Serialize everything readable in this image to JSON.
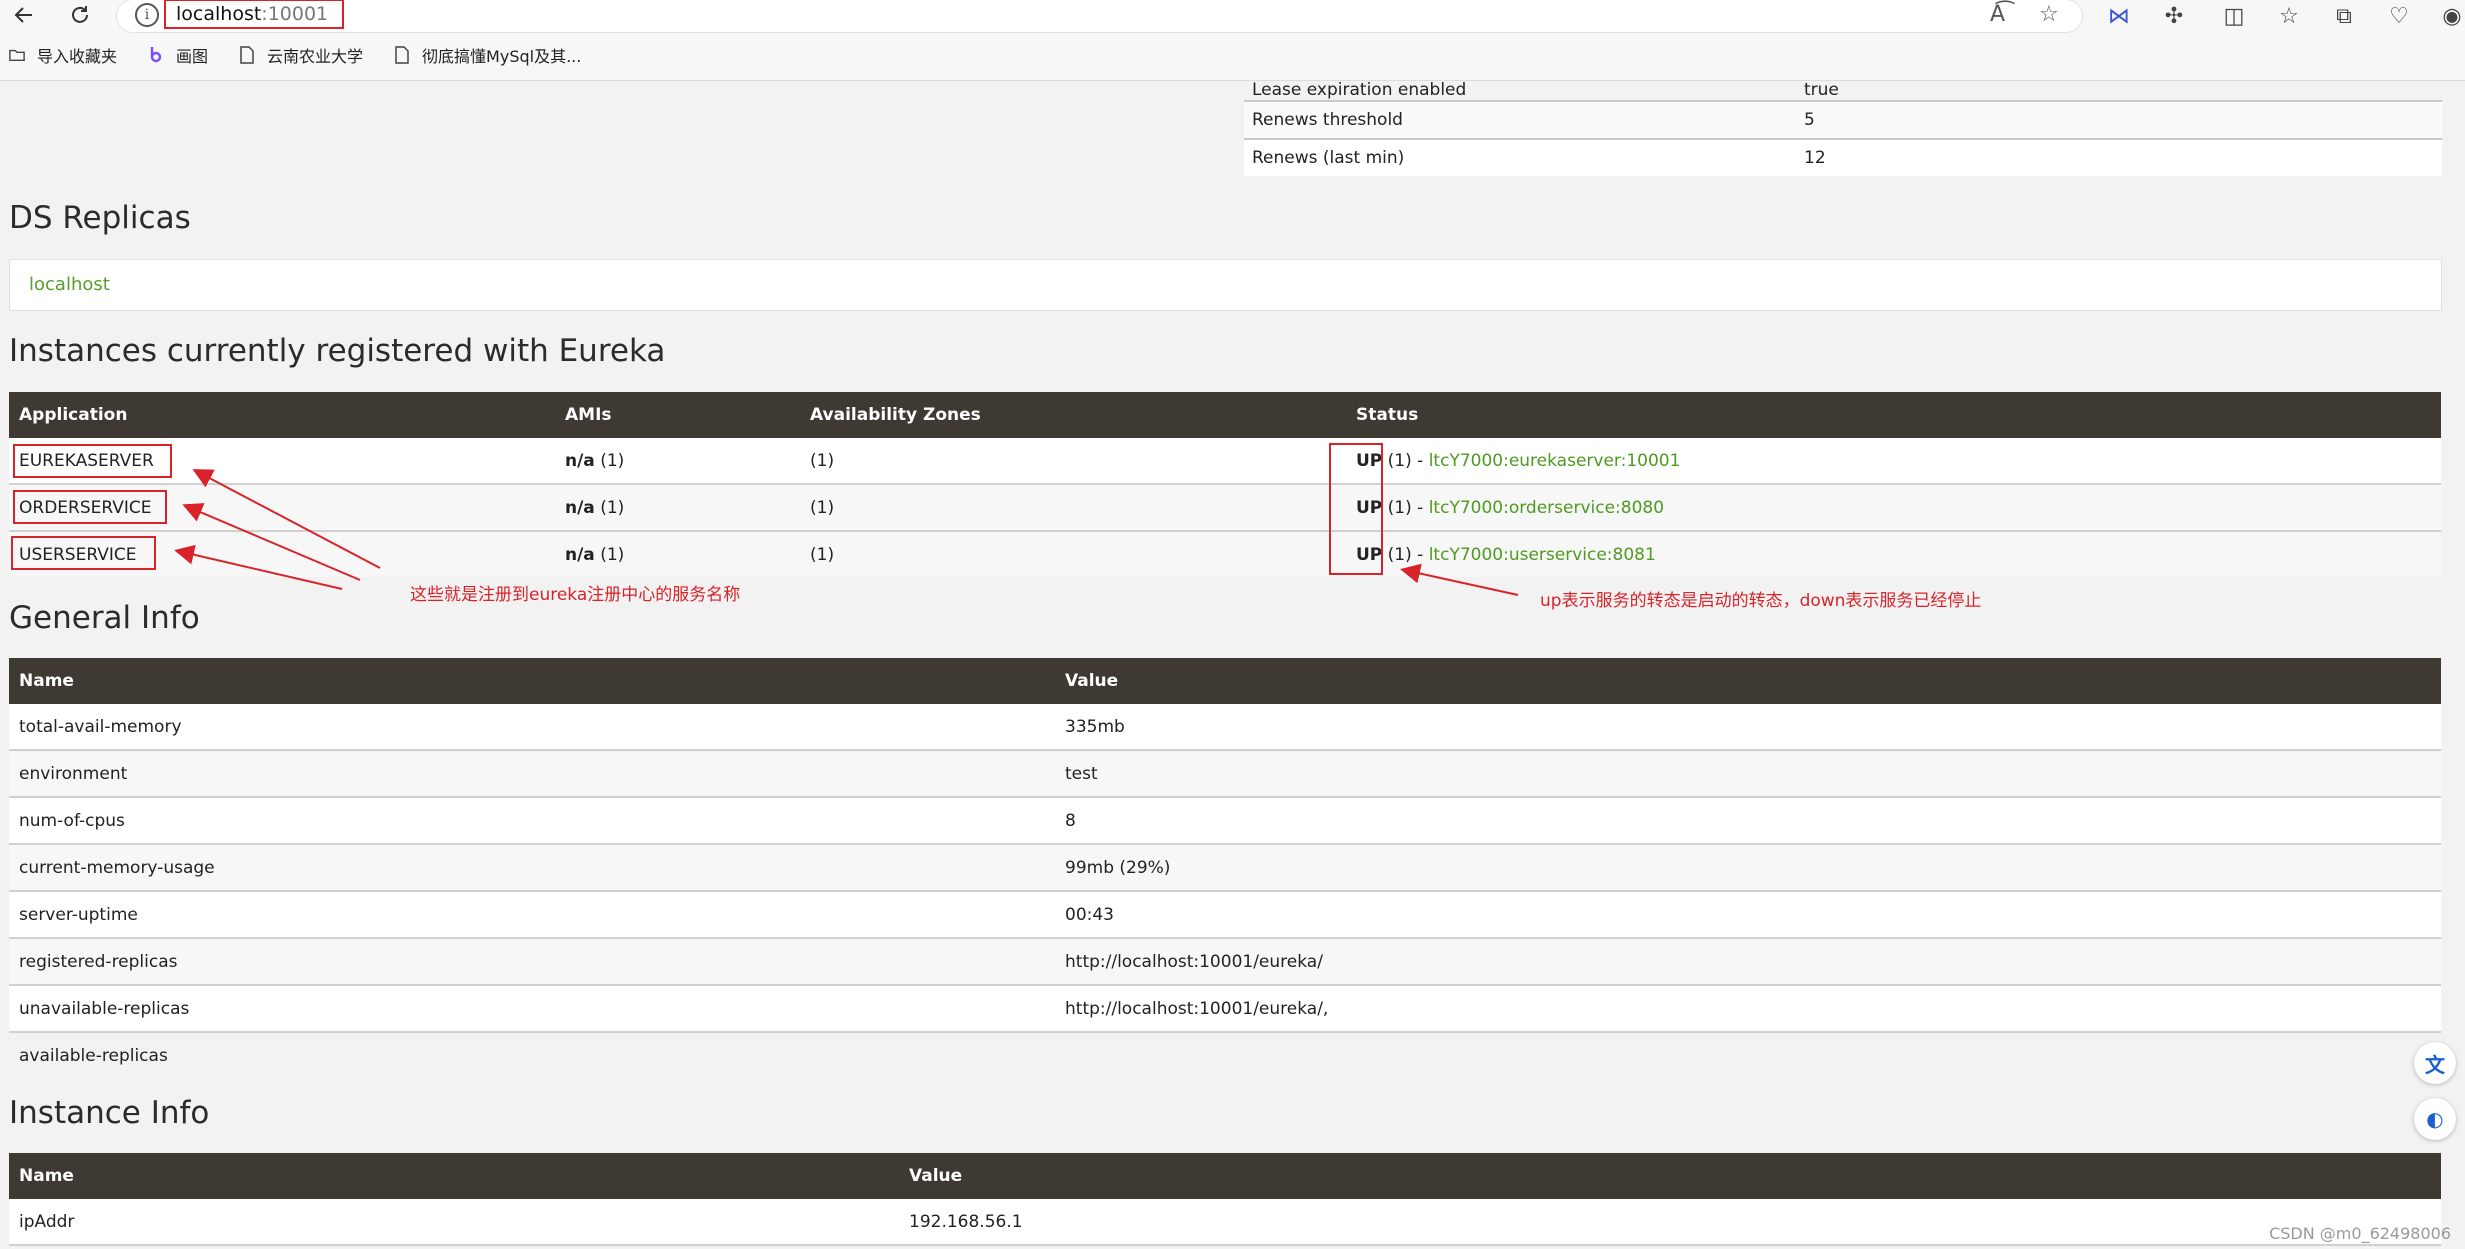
{
  "browser": {
    "address": {
      "host": "localhost",
      "port": ":10001"
    },
    "bookmarks": [
      {
        "label": "导入收藏夹",
        "icon": "folder-import-icon"
      },
      {
        "label": "画图",
        "icon": "paint-icon"
      },
      {
        "label": "云南农业大学",
        "icon": "page-icon"
      },
      {
        "label": "彻底搞懂MySql及其...",
        "icon": "page-icon"
      }
    ]
  },
  "lease": {
    "rows": [
      {
        "name": "Lease expiration enabled",
        "value": "true"
      },
      {
        "name": "Renews threshold",
        "value": "5"
      },
      {
        "name": "Renews (last min)",
        "value": "12"
      }
    ]
  },
  "ds_replicas": {
    "title": "DS Replicas",
    "link": "localhost"
  },
  "instances": {
    "title": "Instances currently registered with Eureka",
    "headers": [
      "Application",
      "AMIs",
      "Availability Zones",
      "Status"
    ],
    "rows": [
      {
        "app": "EUREKASERVER",
        "amis_bold": "n/a",
        "amis_count": " (1)",
        "zones": "(1)",
        "status": "UP",
        "status_count": " (1) - ",
        "instance": "ltcY7000:eurekaserver:10001"
      },
      {
        "app": "ORDERSERVICE",
        "amis_bold": "n/a",
        "amis_count": " (1)",
        "zones": "(1)",
        "status": "UP",
        "status_count": " (1) - ",
        "instance": "ltcY7000:orderservice:8080"
      },
      {
        "app": "USERSERVICE",
        "amis_bold": "n/a",
        "amis_count": " (1)",
        "zones": "(1)",
        "status": "UP",
        "status_count": " (1) - ",
        "instance": "ltcY7000:userservice:8081"
      }
    ]
  },
  "annotations": {
    "names_note": "这些就是注册到eureka注册中心的服务名称",
    "status_note": "up表示服务的转态是启动的转态，down表示服务已经停止",
    "color": "#d9232a"
  },
  "general_info": {
    "title": "General Info",
    "headers": [
      "Name",
      "Value"
    ],
    "rows": [
      {
        "name": "total-avail-memory",
        "value": "335mb"
      },
      {
        "name": "environment",
        "value": "test"
      },
      {
        "name": "num-of-cpus",
        "value": "8"
      },
      {
        "name": "current-memory-usage",
        "value": "99mb (29%)"
      },
      {
        "name": "server-uptime",
        "value": "00:43"
      },
      {
        "name": "registered-replicas",
        "value": "http://localhost:10001/eureka/"
      },
      {
        "name": "unavailable-replicas",
        "value": "http://localhost:10001/eureka/,"
      },
      {
        "name": "available-replicas",
        "value": ""
      }
    ]
  },
  "instance_info": {
    "title": "Instance Info",
    "headers": [
      "Name",
      "Value"
    ],
    "rows": [
      {
        "name": "ipAddr",
        "value": "192.168.56.1"
      }
    ]
  },
  "side_buttons": [
    "translate-icon",
    "assistant-icon"
  ],
  "watermark": "CSDN @m0_62498006",
  "colors": {
    "header": "#3e3932",
    "link": "#4f9a1f",
    "annotation": "#d9232a"
  }
}
